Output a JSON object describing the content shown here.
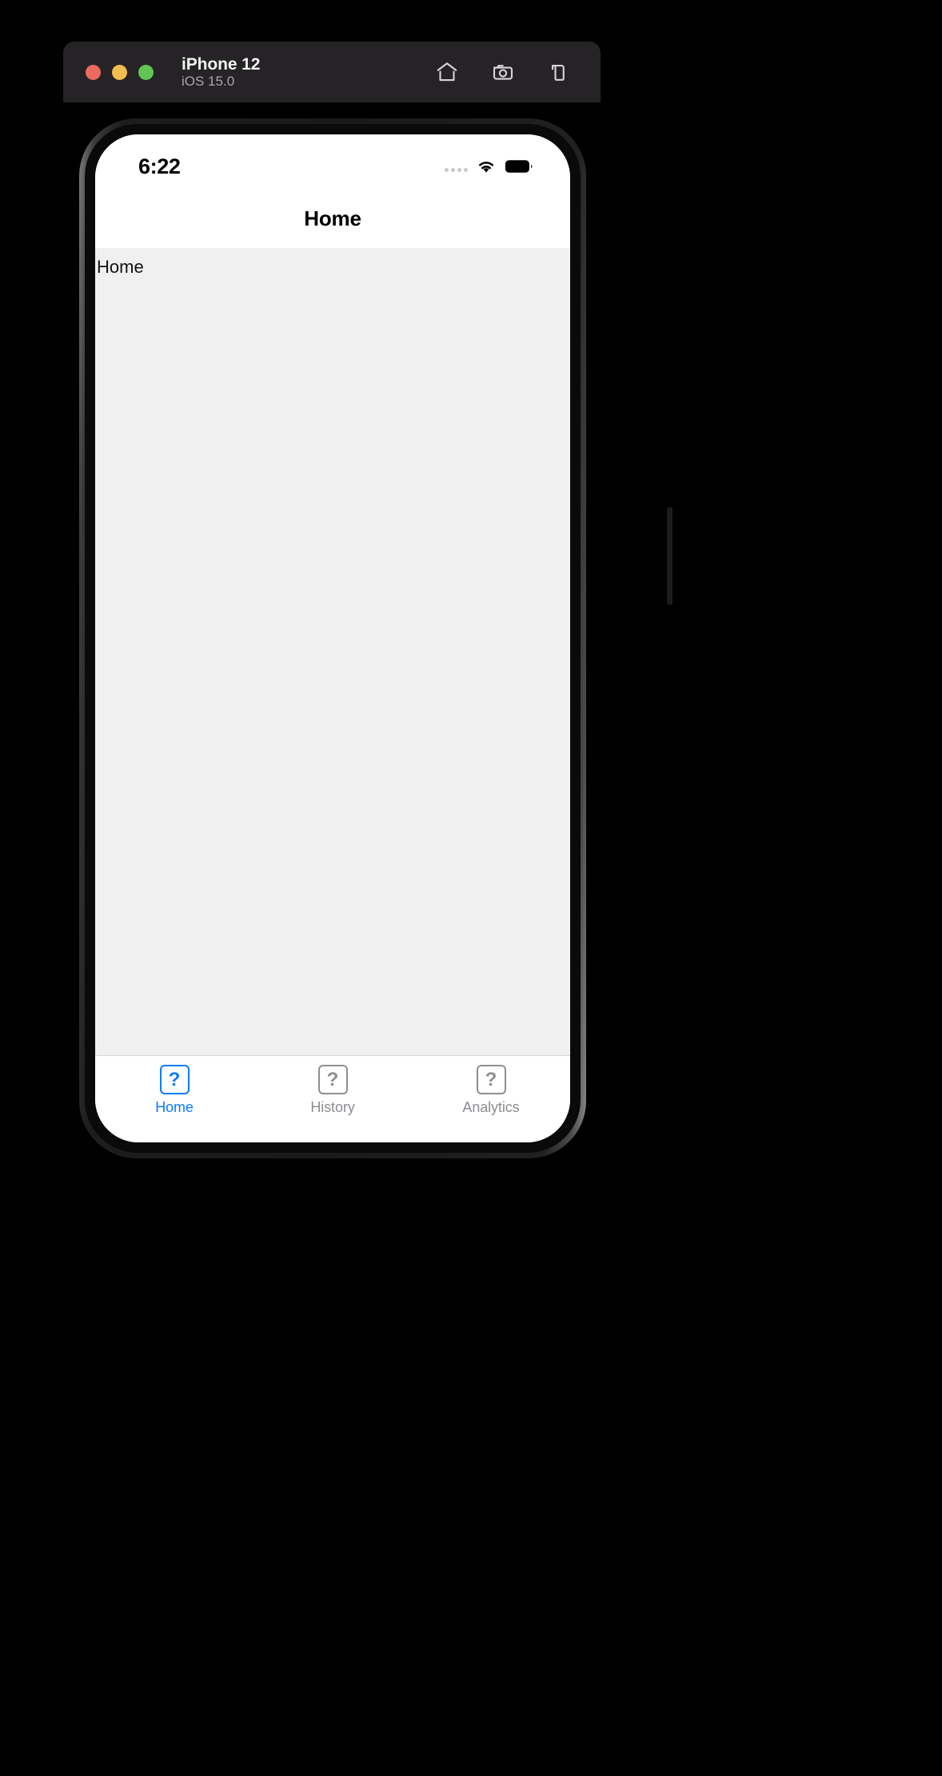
{
  "simulator": {
    "title": "iPhone 12",
    "subtitle": "iOS 15.0",
    "traffic_lights": [
      {
        "name": "close",
        "color": "#ec6a5f"
      },
      {
        "name": "minimize",
        "color": "#f4bd4f"
      },
      {
        "name": "maximize",
        "color": "#61c555"
      }
    ],
    "actions": [
      {
        "name": "home-icon",
        "label": "Home"
      },
      {
        "name": "screenshot-icon",
        "label": "Screenshot"
      },
      {
        "name": "rotate-icon",
        "label": "Rotate"
      }
    ],
    "chrome_color": "#262326"
  },
  "status_bar": {
    "time": "6:22",
    "cellular_icon": "cellular-dots-icon",
    "wifi_icon": "wifi-icon",
    "battery_icon": "battery-full-icon"
  },
  "nav_bar": {
    "title": "Home"
  },
  "content": {
    "text": "Home",
    "background": "#f0f0f0"
  },
  "tab_bar": {
    "accent_color": "#0a7cff",
    "inactive_color": "#8e8e93",
    "tabs": [
      {
        "label": "Home",
        "icon": "?",
        "icon_name": "placeholder-question-icon",
        "active": true
      },
      {
        "label": "History",
        "icon": "?",
        "icon_name": "placeholder-question-icon",
        "active": false
      },
      {
        "label": "Analytics",
        "icon": "?",
        "icon_name": "placeholder-question-icon",
        "active": false
      }
    ]
  }
}
